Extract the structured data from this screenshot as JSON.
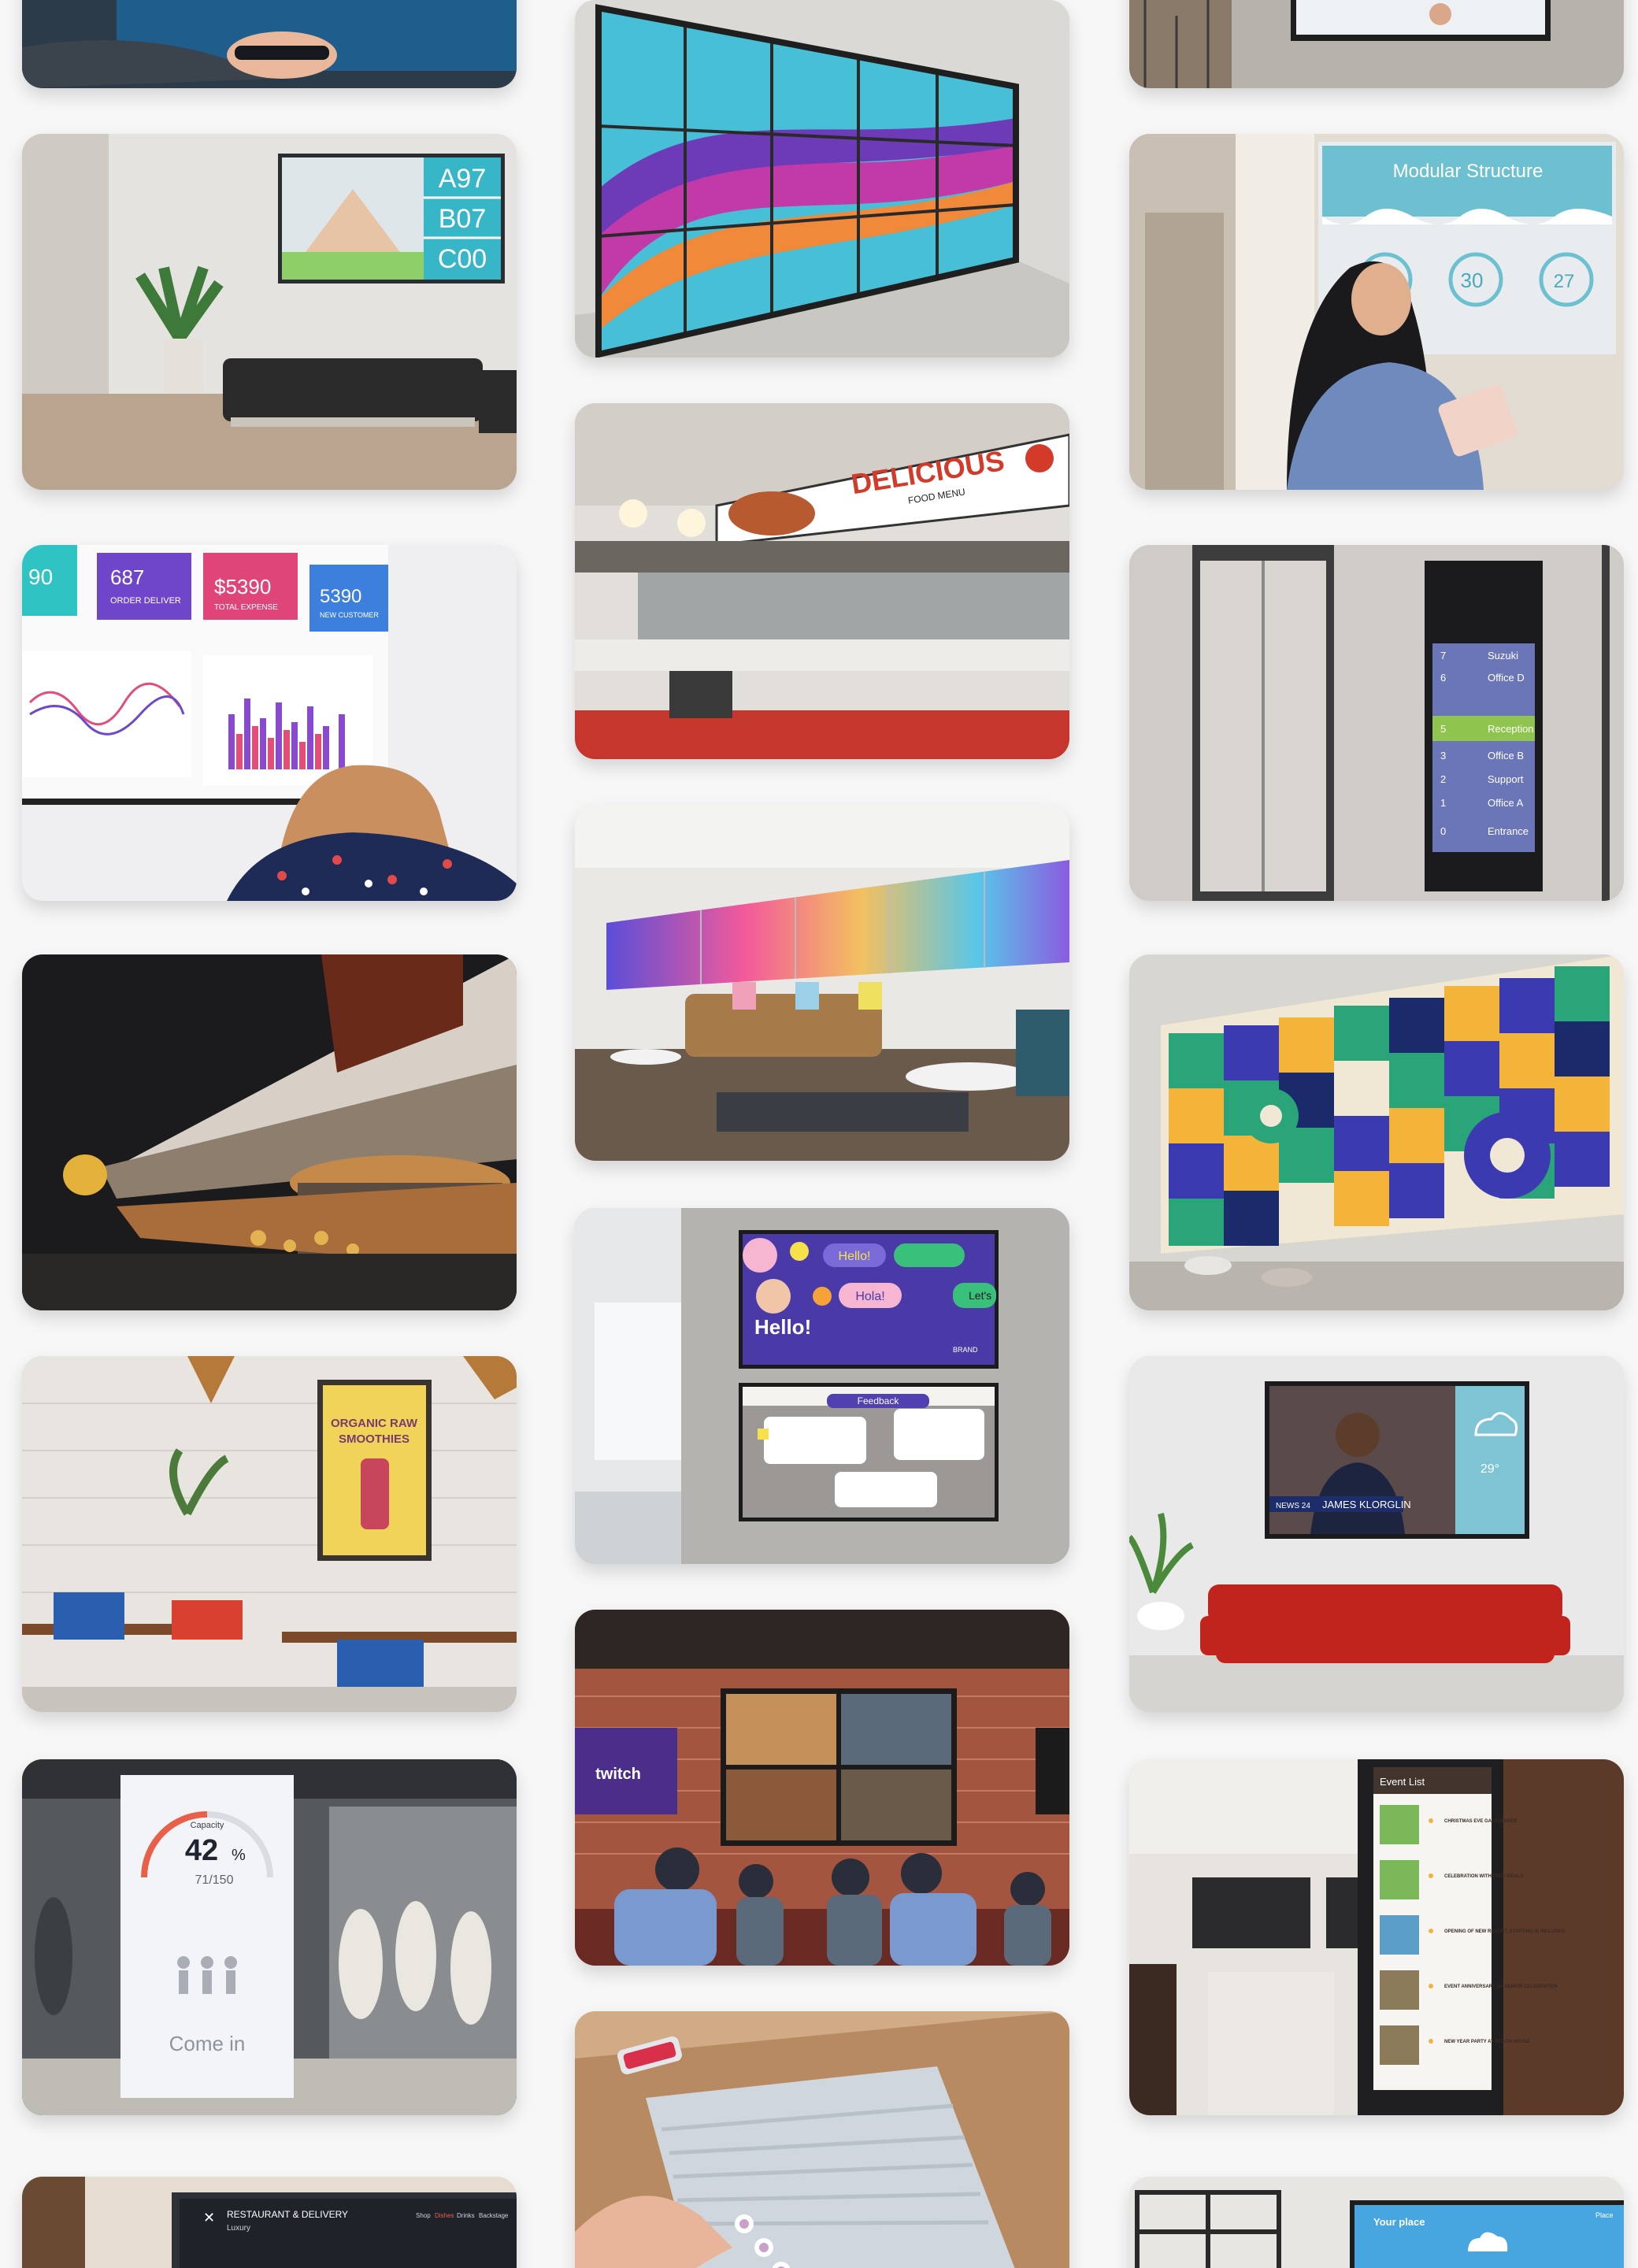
{
  "gallery": {
    "cards": [
      {
        "id": "hand-touchscreen"
      },
      {
        "id": "waiting-room-queue",
        "queue": [
          "A97",
          "B07",
          "C00"
        ]
      },
      {
        "id": "dashboard-display",
        "kpis": [
          "687",
          "$5390",
          "5390"
        ],
        "kpi_labels": [
          "ORDER DELIVER",
          "TOTAL EXPENSE",
          "NEW CUSTOMER"
        ],
        "left_kpi": "90"
      },
      {
        "id": "food-court-menu-screens"
      },
      {
        "id": "cafe-poster",
        "poster_title_1": "ORGANIC RAW",
        "poster_title_2": "SMOOTHIES"
      },
      {
        "id": "retail-capacity",
        "capacity_label": "Capacity",
        "capacity_percent": "42",
        "capacity_unit": "%",
        "capacity_count": "71/150",
        "cta": "Come in"
      },
      {
        "id": "restaurant-delivery",
        "brand_line_1": "RESTAURANT & DELIVERY",
        "brand_line_2": "Luxury",
        "nav": [
          "Shop",
          "Dishes",
          "Drinks",
          "Backstage"
        ]
      },
      {
        "id": "videowall-ribbon"
      },
      {
        "id": "deli-menu",
        "menu_title": "DELICIOUS",
        "menu_sub": "FOOD MENU"
      },
      {
        "id": "lounge-videowall"
      },
      {
        "id": "social-screens",
        "hello_bubble": "Hello!",
        "hola_bubble": "Hola!",
        "lets_bubble": "Let's",
        "headline": "Hello!",
        "brand": "BRAND",
        "feedback_tab": "Feedback"
      },
      {
        "id": "gaming-bar-wall",
        "twitch": "twitch"
      },
      {
        "id": "touch-table"
      },
      {
        "id": "office-display-top"
      },
      {
        "id": "modular-structure",
        "headline": "Modular Structure",
        "stats": [
          "14",
          "30",
          "27"
        ],
        "stat_suffix": "%"
      },
      {
        "id": "elevator-directory",
        "floors": [
          {
            "n": "7",
            "name": "Suzuki"
          },
          {
            "n": "6",
            "name": "Office D"
          },
          {
            "n": "",
            "name": ""
          },
          {
            "n": "5",
            "name": "Reception"
          },
          {
            "n": "3",
            "name": "Office B"
          },
          {
            "n": "2",
            "name": "Support"
          },
          {
            "n": "1",
            "name": "Office A"
          },
          {
            "n": "0",
            "name": "Entrance"
          }
        ]
      },
      {
        "id": "geometric-videowall"
      },
      {
        "id": "news-weather",
        "anchor_name": "JAMES KLORGLIN",
        "channel": "NEWS 24",
        "temperature": "29°"
      },
      {
        "id": "event-list",
        "title": "Event List",
        "events": [
          "CHRISTMAS EVE GALA DINNER",
          "CELEBRATION WITH FREE MEALS",
          "OPENING OF NEW RESORT, STARTING IS INCLUDED",
          "EVENT ANNIVERSARY OF SENIOR CELEBRATION",
          "NEW YEAR PARTY AT BEACH HOUSE"
        ]
      },
      {
        "id": "your-place",
        "title": "Your place",
        "corner": "Place"
      }
    ]
  },
  "colors": {
    "page_bg": "#f7f7f8",
    "accent_teal": "#39b2c3",
    "accent_purple": "#3a2f88"
  }
}
